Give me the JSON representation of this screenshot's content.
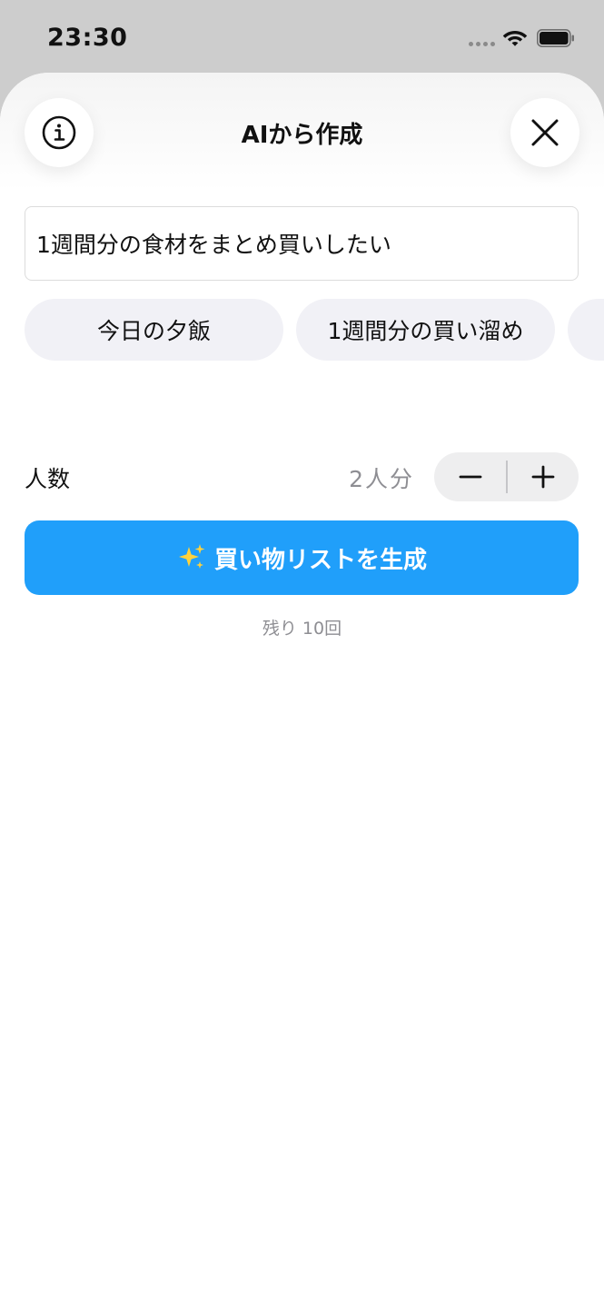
{
  "status_bar": {
    "time": "23:30"
  },
  "header": {
    "title": "AIから作成",
    "info_icon": "info-circle-icon",
    "close_icon": "close-x-icon"
  },
  "prompt": {
    "value": "1週間分の食材をまとめ買いしたい"
  },
  "chips": [
    {
      "label": "今日の夕飯"
    },
    {
      "label": "1週間分の買い溜め"
    },
    {
      "label": ""
    }
  ],
  "people": {
    "label": "人数",
    "value": "2人分",
    "minus_icon": "minus-icon",
    "plus_icon": "plus-icon"
  },
  "generate": {
    "label": "買い物リストを生成",
    "icon": "sparkles-icon"
  },
  "remaining": {
    "text": "残り 10回"
  },
  "colors": {
    "accent": "#209ffa",
    "chip_bg": "#f1f1f6",
    "muted_text": "#8e8e93"
  }
}
